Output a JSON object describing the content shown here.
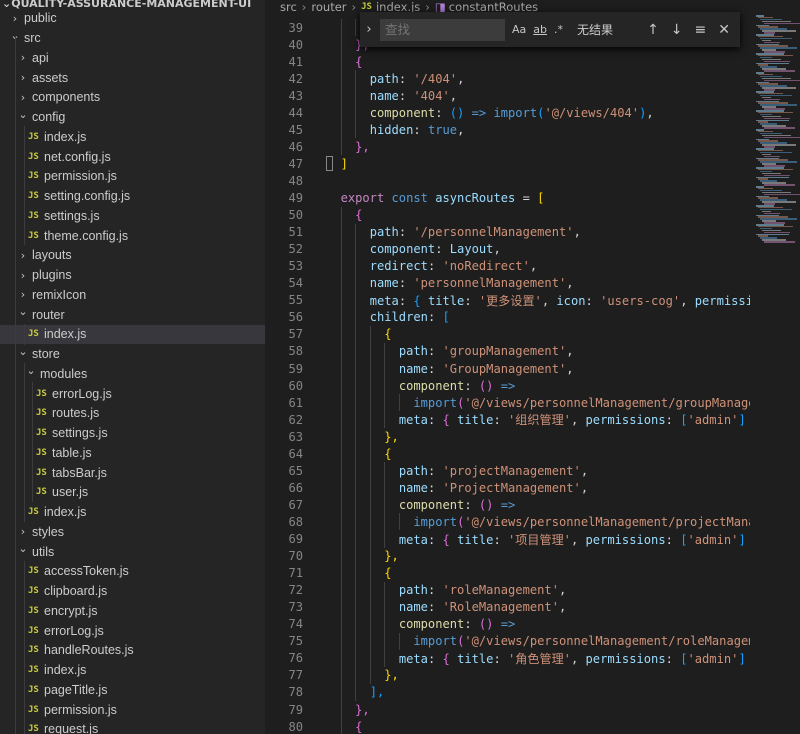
{
  "explorer": {
    "section_title": "QUALITY-ASSURANCE-MANAGEMENT-UI",
    "items": [
      {
        "label": "public",
        "kind": "folder",
        "depth": 1,
        "open": false
      },
      {
        "label": "src",
        "kind": "folder",
        "depth": 1,
        "open": true
      },
      {
        "label": "api",
        "kind": "folder",
        "depth": 2,
        "open": false
      },
      {
        "label": "assets",
        "kind": "folder",
        "depth": 2,
        "open": false
      },
      {
        "label": "components",
        "kind": "folder",
        "depth": 2,
        "open": false
      },
      {
        "label": "config",
        "kind": "folder",
        "depth": 2,
        "open": true
      },
      {
        "label": "index.js",
        "kind": "file",
        "depth": 3
      },
      {
        "label": "net.config.js",
        "kind": "file",
        "depth": 3
      },
      {
        "label": "permission.js",
        "kind": "file",
        "depth": 3
      },
      {
        "label": "setting.config.js",
        "kind": "file",
        "depth": 3
      },
      {
        "label": "settings.js",
        "kind": "file",
        "depth": 3
      },
      {
        "label": "theme.config.js",
        "kind": "file",
        "depth": 3
      },
      {
        "label": "layouts",
        "kind": "folder",
        "depth": 2,
        "open": false
      },
      {
        "label": "plugins",
        "kind": "folder",
        "depth": 2,
        "open": false
      },
      {
        "label": "remixIcon",
        "kind": "folder",
        "depth": 2,
        "open": false
      },
      {
        "label": "router",
        "kind": "folder",
        "depth": 2,
        "open": true
      },
      {
        "label": "index.js",
        "kind": "file",
        "depth": 3,
        "selected": true
      },
      {
        "label": "store",
        "kind": "folder",
        "depth": 2,
        "open": true
      },
      {
        "label": "modules",
        "kind": "folder",
        "depth": 3,
        "open": true
      },
      {
        "label": "errorLog.js",
        "kind": "file",
        "depth": 4
      },
      {
        "label": "routes.js",
        "kind": "file",
        "depth": 4
      },
      {
        "label": "settings.js",
        "kind": "file",
        "depth": 4
      },
      {
        "label": "table.js",
        "kind": "file",
        "depth": 4
      },
      {
        "label": "tabsBar.js",
        "kind": "file",
        "depth": 4
      },
      {
        "label": "user.js",
        "kind": "file",
        "depth": 4
      },
      {
        "label": "index.js",
        "kind": "file",
        "depth": 3
      },
      {
        "label": "styles",
        "kind": "folder",
        "depth": 2,
        "open": false
      },
      {
        "label": "utils",
        "kind": "folder",
        "depth": 2,
        "open": true
      },
      {
        "label": "accessToken.js",
        "kind": "file",
        "depth": 3
      },
      {
        "label": "clipboard.js",
        "kind": "file",
        "depth": 3
      },
      {
        "label": "encrypt.js",
        "kind": "file",
        "depth": 3
      },
      {
        "label": "errorLog.js",
        "kind": "file",
        "depth": 3
      },
      {
        "label": "handleRoutes.js",
        "kind": "file",
        "depth": 3
      },
      {
        "label": "index.js",
        "kind": "file",
        "depth": 3
      },
      {
        "label": "pageTitle.js",
        "kind": "file",
        "depth": 3
      },
      {
        "label": "permission.js",
        "kind": "file",
        "depth": 3
      },
      {
        "label": "request.js",
        "kind": "file",
        "depth": 3
      }
    ]
  },
  "breadcrumb": [
    "src",
    "router",
    "index.js",
    "constantRoutes"
  ],
  "find": {
    "placeholder": "查找",
    "opt_case": "Aa",
    "opt_word": "ab",
    "opt_regex": ".*",
    "result": "无结果"
  },
  "icons": {
    "file": "JS",
    "collapsed": "chevron-right-icon",
    "expanded": "chevron-down-icon"
  },
  "code": [
    {
      "n": "39",
      "t": [
        [
          "      h",
          "t-prop"
        ]
      ]
    },
    {
      "n": "40",
      "t": [
        [
          "    ",
          "t-op"
        ],
        [
          "},",
          "b2"
        ]
      ]
    },
    {
      "n": "41",
      "t": [
        [
          "    ",
          "t-op"
        ],
        [
          "{",
          "b2"
        ]
      ]
    },
    {
      "n": "42",
      "t": [
        [
          "      ",
          "t-op"
        ],
        [
          "path",
          "t-prop"
        ],
        [
          ": ",
          "t-op"
        ],
        [
          "'/404'",
          "t-str"
        ],
        [
          ",",
          "t-op"
        ]
      ]
    },
    {
      "n": "43",
      "t": [
        [
          "      ",
          "t-op"
        ],
        [
          "name",
          "t-prop"
        ],
        [
          ": ",
          "t-op"
        ],
        [
          "'404'",
          "t-str"
        ],
        [
          ",",
          "t-op"
        ]
      ]
    },
    {
      "n": "44",
      "t": [
        [
          "      ",
          "t-op"
        ],
        [
          "component",
          "t-fn"
        ],
        [
          ": ",
          "t-op"
        ],
        [
          "()",
          "b3"
        ],
        [
          " ",
          "t-op"
        ],
        [
          "=>",
          "t-kw"
        ],
        [
          " ",
          "t-op"
        ],
        [
          "import",
          "t-kw"
        ],
        [
          "(",
          "b3"
        ],
        [
          "'@/views/404'",
          "t-str"
        ],
        [
          ")",
          "b3"
        ],
        [
          ",",
          "t-op"
        ]
      ]
    },
    {
      "n": "45",
      "t": [
        [
          "      ",
          "t-op"
        ],
        [
          "hidden",
          "t-prop"
        ],
        [
          ": ",
          "t-op"
        ],
        [
          "true",
          "t-kw"
        ],
        [
          ",",
          "t-op"
        ]
      ]
    },
    {
      "n": "46",
      "t": [
        [
          "    ",
          "t-op"
        ],
        [
          "},",
          "b2"
        ]
      ]
    },
    {
      "n": "47",
      "t": [
        [
          "  ",
          "t-op"
        ],
        [
          "]",
          "b1"
        ]
      ]
    },
    {
      "n": "48",
      "t": []
    },
    {
      "n": "49",
      "t": [
        [
          "  ",
          "t-op"
        ],
        [
          "export",
          "t-key"
        ],
        [
          " ",
          "t-op"
        ],
        [
          "const",
          "t-kw"
        ],
        [
          " ",
          "t-op"
        ],
        [
          "asyncRoutes",
          "t-var"
        ],
        [
          " = ",
          "t-op"
        ],
        [
          "[",
          "b1"
        ]
      ]
    },
    {
      "n": "50",
      "t": [
        [
          "    ",
          "t-op"
        ],
        [
          "{",
          "b2"
        ]
      ]
    },
    {
      "n": "51",
      "t": [
        [
          "      ",
          "t-op"
        ],
        [
          "path",
          "t-prop"
        ],
        [
          ": ",
          "t-op"
        ],
        [
          "'/personnelManagement'",
          "t-str"
        ],
        [
          ",",
          "t-op"
        ]
      ]
    },
    {
      "n": "52",
      "t": [
        [
          "      ",
          "t-op"
        ],
        [
          "component",
          "t-prop"
        ],
        [
          ": ",
          "t-op"
        ],
        [
          "Layout",
          "t-var"
        ],
        [
          ",",
          "t-op"
        ]
      ]
    },
    {
      "n": "53",
      "t": [
        [
          "      ",
          "t-op"
        ],
        [
          "redirect",
          "t-prop"
        ],
        [
          ": ",
          "t-op"
        ],
        [
          "'noRedirect'",
          "t-str"
        ],
        [
          ",",
          "t-op"
        ]
      ]
    },
    {
      "n": "54",
      "t": [
        [
          "      ",
          "t-op"
        ],
        [
          "name",
          "t-prop"
        ],
        [
          ": ",
          "t-op"
        ],
        [
          "'personnelManagement'",
          "t-str"
        ],
        [
          ",",
          "t-op"
        ]
      ]
    },
    {
      "n": "55",
      "t": [
        [
          "      ",
          "t-op"
        ],
        [
          "meta",
          "t-prop"
        ],
        [
          ": ",
          "t-op"
        ],
        [
          "{",
          "b3"
        ],
        [
          " ",
          "t-op"
        ],
        [
          "title",
          "t-prop"
        ],
        [
          ": ",
          "t-op"
        ],
        [
          "'更多设置'",
          "t-str"
        ],
        [
          ", ",
          "t-op"
        ],
        [
          "icon",
          "t-prop"
        ],
        [
          ": ",
          "t-op"
        ],
        [
          "'users-cog'",
          "t-str"
        ],
        [
          ", ",
          "t-op"
        ],
        [
          "permissions",
          "t-prop"
        ],
        [
          ":",
          "t-op"
        ]
      ]
    },
    {
      "n": "56",
      "t": [
        [
          "      ",
          "t-op"
        ],
        [
          "children",
          "t-prop"
        ],
        [
          ": ",
          "t-op"
        ],
        [
          "[",
          "b3"
        ]
      ]
    },
    {
      "n": "57",
      "t": [
        [
          "        ",
          "t-op"
        ],
        [
          "{",
          "b1"
        ]
      ]
    },
    {
      "n": "58",
      "t": [
        [
          "          ",
          "t-op"
        ],
        [
          "path",
          "t-prop"
        ],
        [
          ": ",
          "t-op"
        ],
        [
          "'groupManagement'",
          "t-str"
        ],
        [
          ",",
          "t-op"
        ]
      ]
    },
    {
      "n": "59",
      "t": [
        [
          "          ",
          "t-op"
        ],
        [
          "name",
          "t-prop"
        ],
        [
          ": ",
          "t-op"
        ],
        [
          "'GroupManagement'",
          "t-str"
        ],
        [
          ",",
          "t-op"
        ]
      ]
    },
    {
      "n": "60",
      "t": [
        [
          "          ",
          "t-op"
        ],
        [
          "component",
          "t-fn"
        ],
        [
          ": ",
          "t-op"
        ],
        [
          "()",
          "b2"
        ],
        [
          " ",
          "t-op"
        ],
        [
          "=>",
          "t-kw"
        ]
      ]
    },
    {
      "n": "61",
      "t": [
        [
          "            ",
          "t-op"
        ],
        [
          "import",
          "t-kw"
        ],
        [
          "(",
          "b2"
        ],
        [
          "'@/views/personnelManagement/groupManagement/",
          "t-str"
        ]
      ]
    },
    {
      "n": "62",
      "t": [
        [
          "          ",
          "t-op"
        ],
        [
          "meta",
          "t-prop"
        ],
        [
          ": ",
          "t-op"
        ],
        [
          "{",
          "b2"
        ],
        [
          " ",
          "t-op"
        ],
        [
          "title",
          "t-prop"
        ],
        [
          ": ",
          "t-op"
        ],
        [
          "'组织管理'",
          "t-str"
        ],
        [
          ", ",
          "t-op"
        ],
        [
          "permissions",
          "t-prop"
        ],
        [
          ": ",
          "t-op"
        ],
        [
          "[",
          "b3"
        ],
        [
          "'admin'",
          "t-str"
        ],
        [
          "]",
          "b3"
        ],
        [
          " ",
          "t-op"
        ],
        [
          "}",
          "b2"
        ],
        [
          ",",
          "t-op"
        ]
      ]
    },
    {
      "n": "63",
      "t": [
        [
          "        ",
          "t-op"
        ],
        [
          "},",
          "b1"
        ]
      ]
    },
    {
      "n": "64",
      "t": [
        [
          "        ",
          "t-op"
        ],
        [
          "{",
          "b1"
        ]
      ]
    },
    {
      "n": "65",
      "t": [
        [
          "          ",
          "t-op"
        ],
        [
          "path",
          "t-prop"
        ],
        [
          ": ",
          "t-op"
        ],
        [
          "'projectManagement'",
          "t-str"
        ],
        [
          ",",
          "t-op"
        ]
      ]
    },
    {
      "n": "66",
      "t": [
        [
          "          ",
          "t-op"
        ],
        [
          "name",
          "t-prop"
        ],
        [
          ": ",
          "t-op"
        ],
        [
          "'ProjectManagement'",
          "t-str"
        ],
        [
          ",",
          "t-op"
        ]
      ]
    },
    {
      "n": "67",
      "t": [
        [
          "          ",
          "t-op"
        ],
        [
          "component",
          "t-fn"
        ],
        [
          ": ",
          "t-op"
        ],
        [
          "()",
          "b2"
        ],
        [
          " ",
          "t-op"
        ],
        [
          "=>",
          "t-kw"
        ]
      ]
    },
    {
      "n": "68",
      "t": [
        [
          "            ",
          "t-op"
        ],
        [
          "import",
          "t-kw"
        ],
        [
          "(",
          "b2"
        ],
        [
          "'@/views/personnelManagement/projectManagemen",
          "t-str"
        ]
      ]
    },
    {
      "n": "69",
      "t": [
        [
          "          ",
          "t-op"
        ],
        [
          "meta",
          "t-prop"
        ],
        [
          ": ",
          "t-op"
        ],
        [
          "{",
          "b2"
        ],
        [
          " ",
          "t-op"
        ],
        [
          "title",
          "t-prop"
        ],
        [
          ": ",
          "t-op"
        ],
        [
          "'项目管理'",
          "t-str"
        ],
        [
          ", ",
          "t-op"
        ],
        [
          "permissions",
          "t-prop"
        ],
        [
          ": ",
          "t-op"
        ],
        [
          "[",
          "b3"
        ],
        [
          "'admin'",
          "t-str"
        ],
        [
          "]",
          "b3"
        ],
        [
          " ",
          "t-op"
        ],
        [
          "}",
          "b2"
        ],
        [
          ",",
          "t-op"
        ]
      ]
    },
    {
      "n": "70",
      "t": [
        [
          "        ",
          "t-op"
        ],
        [
          "},",
          "b1"
        ]
      ]
    },
    {
      "n": "71",
      "t": [
        [
          "        ",
          "t-op"
        ],
        [
          "{",
          "b1"
        ]
      ]
    },
    {
      "n": "72",
      "t": [
        [
          "          ",
          "t-op"
        ],
        [
          "path",
          "t-prop"
        ],
        [
          ": ",
          "t-op"
        ],
        [
          "'roleManagement'",
          "t-str"
        ],
        [
          ",",
          "t-op"
        ]
      ]
    },
    {
      "n": "73",
      "t": [
        [
          "          ",
          "t-op"
        ],
        [
          "name",
          "t-prop"
        ],
        [
          ": ",
          "t-op"
        ],
        [
          "'RoleManagement'",
          "t-str"
        ],
        [
          ",",
          "t-op"
        ]
      ]
    },
    {
      "n": "74",
      "t": [
        [
          "          ",
          "t-op"
        ],
        [
          "component",
          "t-fn"
        ],
        [
          ": ",
          "t-op"
        ],
        [
          "()",
          "b2"
        ],
        [
          " ",
          "t-op"
        ],
        [
          "=>",
          "t-kw"
        ]
      ]
    },
    {
      "n": "75",
      "t": [
        [
          "            ",
          "t-op"
        ],
        [
          "import",
          "t-kw"
        ],
        [
          "(",
          "b2"
        ],
        [
          "'@/views/personnelManagement/roleManagement/i",
          "t-str"
        ]
      ]
    },
    {
      "n": "76",
      "t": [
        [
          "          ",
          "t-op"
        ],
        [
          "meta",
          "t-prop"
        ],
        [
          ": ",
          "t-op"
        ],
        [
          "{",
          "b2"
        ],
        [
          " ",
          "t-op"
        ],
        [
          "title",
          "t-prop"
        ],
        [
          ": ",
          "t-op"
        ],
        [
          "'角色管理'",
          "t-str"
        ],
        [
          ", ",
          "t-op"
        ],
        [
          "permissions",
          "t-prop"
        ],
        [
          ": ",
          "t-op"
        ],
        [
          "[",
          "b3"
        ],
        [
          "'admin'",
          "t-str"
        ],
        [
          "]",
          "b3"
        ],
        [
          " ",
          "t-op"
        ],
        [
          "}",
          "b2"
        ],
        [
          ",",
          "t-op"
        ]
      ]
    },
    {
      "n": "77",
      "t": [
        [
          "        ",
          "t-op"
        ],
        [
          "},",
          "b1"
        ]
      ]
    },
    {
      "n": "78",
      "t": [
        [
          "      ",
          "t-op"
        ],
        [
          "],",
          "b3"
        ]
      ]
    },
    {
      "n": "79",
      "t": [
        [
          "    ",
          "t-op"
        ],
        [
          "},",
          "b2"
        ]
      ]
    },
    {
      "n": "80",
      "t": [
        [
          "    ",
          "t-op"
        ],
        [
          "{",
          "b2"
        ]
      ]
    }
  ]
}
